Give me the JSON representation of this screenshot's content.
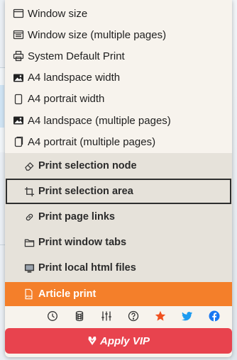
{
  "menu": {
    "items": [
      {
        "label": "Window size",
        "icon": "window-icon"
      },
      {
        "label": "Window size (multiple pages)",
        "icon": "multi-window-icon"
      },
      {
        "label": "System Default Print",
        "icon": "printer-icon"
      },
      {
        "label": "A4 landspace width",
        "icon": "image-landscape-icon"
      },
      {
        "label": "A4 portrait width",
        "icon": "page-portrait-icon"
      },
      {
        "label": "A4 landspace (multiple pages)",
        "icon": "image-landscape-multi-icon"
      },
      {
        "label": "A4 portrait (multiple pages)",
        "icon": "page-portrait-multi-icon"
      }
    ],
    "tools": [
      {
        "label": "Print selection node",
        "icon": "eraser-icon",
        "selected": false
      },
      {
        "label": "Print selection area",
        "icon": "crop-icon",
        "selected": true
      },
      {
        "label": "Print page links",
        "icon": "link-icon",
        "selected": false
      },
      {
        "label": "Print window tabs",
        "icon": "folder-icon",
        "selected": false
      },
      {
        "label": "Print local html files",
        "icon": "monitor-icon",
        "selected": false
      }
    ],
    "article_label": "Article print"
  },
  "toolbar": {
    "icons": [
      "history-icon",
      "database-icon",
      "sliders-icon",
      "help-icon",
      "star-icon",
      "twitter-icon",
      "facebook-icon"
    ]
  },
  "vip": {
    "label": "Apply VIP"
  },
  "colors": {
    "popup_bg": "#f7f3ed",
    "tools_bg": "#e6e2da",
    "article_bg": "#f47f2a",
    "vip_bg": "#e8434e",
    "star": "#f0511f",
    "twitter": "#1d9bf0",
    "facebook": "#1877f2"
  }
}
